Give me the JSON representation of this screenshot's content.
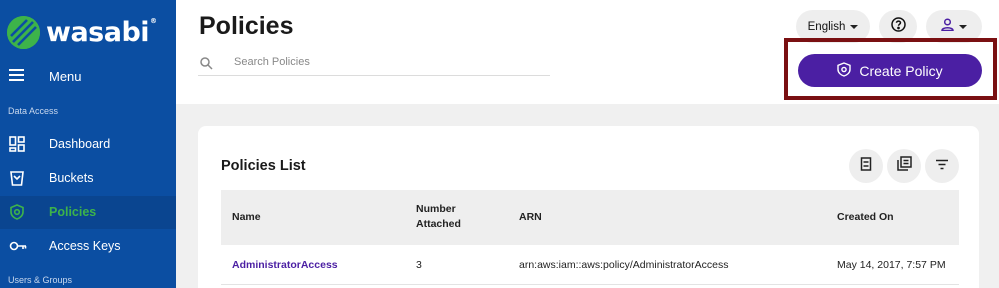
{
  "brand": {
    "name": "wasabi",
    "trademark": "®",
    "logo_color": "#3db34a"
  },
  "sidebar": {
    "menu_label": "Menu",
    "sections": [
      {
        "title": "Data Access"
      },
      {
        "title": "Users & Groups"
      }
    ],
    "items": [
      {
        "label": "Dashboard",
        "icon": "dashboard-icon"
      },
      {
        "label": "Buckets",
        "icon": "bucket-icon"
      },
      {
        "label": "Policies",
        "icon": "policy-shield-icon",
        "active": true
      },
      {
        "label": "Access Keys",
        "icon": "key-icon"
      }
    ],
    "background": "#0b4ea2",
    "active_color": "#3db34a"
  },
  "header": {
    "title": "Policies",
    "search_placeholder": "Search Policies",
    "language": "English",
    "create_button_label": "Create Policy",
    "accent": "#4b1fa3",
    "highlight_frame_color": "#7a1012"
  },
  "card": {
    "title": "Policies List",
    "columns": [
      {
        "label": "Name"
      },
      {
        "label": "Number Attached"
      },
      {
        "label": "ARN"
      },
      {
        "label": "Created On"
      }
    ],
    "rows": [
      {
        "name": "AdministratorAccess",
        "attached": "3",
        "arn": "arn:aws:iam::aws:policy/AdministratorAccess",
        "created": "May 14, 2017, 7:57 PM"
      }
    ]
  }
}
